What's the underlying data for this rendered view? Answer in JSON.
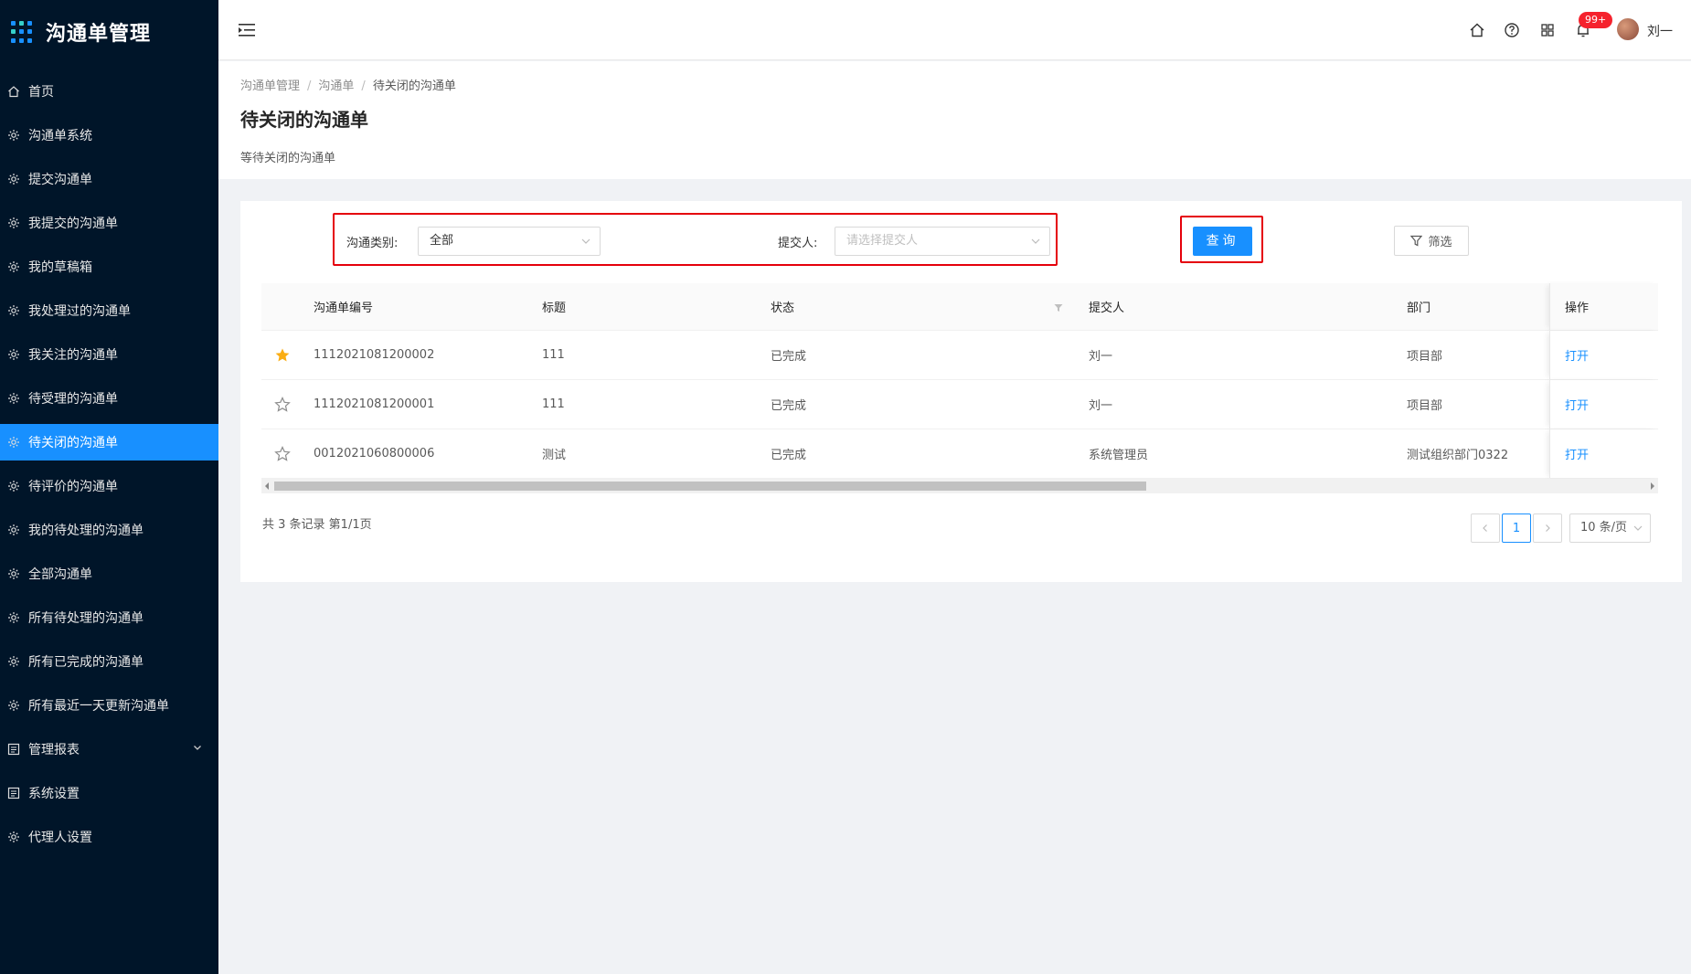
{
  "app": {
    "title": "沟通单管理"
  },
  "sidebar": {
    "items": [
      {
        "label": "首页",
        "icon": "home-icon"
      },
      {
        "label": "沟通单系统",
        "icon": "gear-icon"
      },
      {
        "label": "提交沟通单",
        "icon": "gear-icon"
      },
      {
        "label": "我提交的沟通单",
        "icon": "gear-icon"
      },
      {
        "label": "我的草稿箱",
        "icon": "gear-icon"
      },
      {
        "label": "我处理过的沟通单",
        "icon": "gear-icon"
      },
      {
        "label": "我关注的沟通单",
        "icon": "gear-icon"
      },
      {
        "label": "待受理的沟通单",
        "icon": "gear-icon"
      },
      {
        "label": "待关闭的沟通单",
        "icon": "gear-icon",
        "active": true
      },
      {
        "label": "待评价的沟通单",
        "icon": "gear-icon"
      },
      {
        "label": "我的待处理的沟通单",
        "icon": "gear-icon"
      },
      {
        "label": "全部沟通单",
        "icon": "gear-icon"
      },
      {
        "label": "所有待处理的沟通单",
        "icon": "gear-icon"
      },
      {
        "label": "所有已完成的沟通单",
        "icon": "gear-icon"
      },
      {
        "label": "所有最近一天更新沟通单",
        "icon": "gear-icon"
      },
      {
        "label": "管理报表",
        "icon": "table-icon"
      },
      {
        "label": "系统设置",
        "icon": "table-icon"
      },
      {
        "label": "代理人设置",
        "icon": "gear-icon"
      }
    ]
  },
  "header": {
    "notification_badge": "99+",
    "username": "刘一"
  },
  "page": {
    "breadcrumb": [
      "沟通单管理",
      "沟通单",
      "待关闭的沟通单"
    ],
    "title": "待关闭的沟通单",
    "description": "等待关闭的沟通单"
  },
  "filters": {
    "type_label": "沟通类别:",
    "type_value": "全部",
    "submitter_label": "提交人:",
    "submitter_placeholder": "请选择提交人",
    "query_button": "查询",
    "filter_button": "筛选"
  },
  "table": {
    "columns": [
      "沟通单编号",
      "标题",
      "状态",
      "提交人",
      "部门",
      "操作"
    ],
    "rows": [
      {
        "starred": true,
        "id": "1112021081200002",
        "title": "111",
        "status": "已完成",
        "submitter": "刘一",
        "dept": "项目部",
        "action": "打开"
      },
      {
        "starred": false,
        "id": "1112021081200001",
        "title": "111",
        "status": "已完成",
        "submitter": "刘一",
        "dept": "项目部",
        "action": "打开"
      },
      {
        "starred": false,
        "id": "0012021060800006",
        "title": "测试",
        "status": "已完成",
        "submitter": "系统管理员",
        "dept": "测试组织部门0322",
        "action": "打开"
      }
    ]
  },
  "pagination": {
    "total_text": "共 3 条记录 第1/1页",
    "current_page": "1",
    "page_size": "10 条/页"
  },
  "colors": {
    "sidebar_bg": "#001529",
    "accent": "#1890ff",
    "highlight_border": "#e5000b",
    "star": "#faad14"
  }
}
